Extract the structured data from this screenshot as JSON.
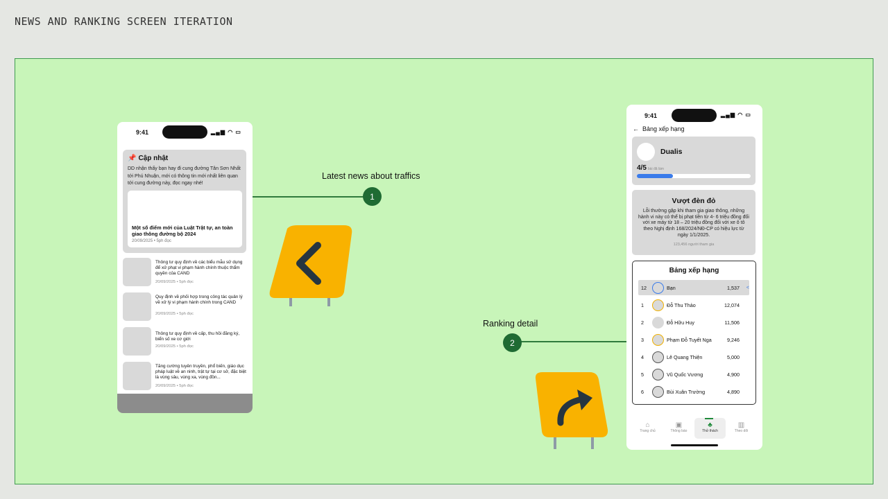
{
  "page": {
    "title": "NEWS AND RANKING SCREEN ITERATION"
  },
  "annotations": [
    {
      "number": "1",
      "label": "Latest news about traffics"
    },
    {
      "number": "2",
      "label": "Ranking detail"
    }
  ],
  "colors": {
    "canvas": "#c8f5b9",
    "sign": "#f9b200",
    "accent": "#1f6b33",
    "progress": "#3a7bea"
  },
  "news_screen": {
    "status_time": "9:41",
    "status_icons": "▂▄▆ ◠ ▭",
    "hero": {
      "icon": "pin-icon",
      "heading": "Cập nhật",
      "description": "DD nhận thấy bạn hay đi cung đường Tân Sơn Nhất tới Phú Nhuận, mới có thông tin mới nhất liên quan tới cung đường này, đọc ngay nhé!",
      "article_title": "Một số điểm mới của Luật Trật tự, an toàn giao thông đường bộ 2024",
      "article_meta": "20/09/2025  •  5ph đọc"
    },
    "items": [
      {
        "title": "Thông tư quy định về các biểu mẫu sử dụng để xử phạt vi phạm hành chính thuộc thẩm quyền của CAND",
        "meta": "20/09/2025  •  5ph đọc"
      },
      {
        "title": "Quy định về phối hợp trong công tác quản lý về xử lý vi phạm hành chính trong CAND",
        "meta": "20/09/2025  •  5ph đọc"
      },
      {
        "title": "Thông tư quy định về cấp, thu hồi đăng ký, biển số xe cơ giới",
        "meta": "20/09/2025  •  5ph đọc"
      },
      {
        "title": "Tăng cường tuyên truyền, phổ biến, giáo dục pháp luật về an ninh, trật tự tại cơ sở, đặc biệt là vùng sâu, vùng xa, vùng đồn...",
        "meta": "20/09/2025  •  5ph đọc"
      }
    ]
  },
  "ranking_screen": {
    "status_time": "9:41",
    "status_icons": "▂▄▆ ◠ ▭",
    "back_arrow": "←",
    "header_title": "Bảng xếp hạng",
    "profile": {
      "name": "Dualis",
      "score": "4/5",
      "score_caption": "bài đã làm",
      "progress": 0.32
    },
    "challenge": {
      "title": "Vượt đèn đỏ",
      "description": "Lỗi thường gặp khi tham gia giao thông, những hành vi này có thể bị phạt tiền từ 4- 6 triệu đồng đối với xe máy từ 18 – 20 triệu đồng đối với xe ô tô theo Nghị định 168/2024/NĐ-CP có hiệu lực từ ngày 1/1/2025.",
      "participants": "123,456 người tham gia"
    },
    "leaderboard": {
      "title": "Bảng xếp hạng",
      "rows": [
        {
          "rank": "12",
          "name": "Bạn",
          "score": "1,537",
          "share": "<"
        },
        {
          "rank": "1",
          "name": "Đỗ Thu Thảo",
          "score": "12,074"
        },
        {
          "rank": "2",
          "name": "Đỗ Hữu Huy",
          "score": "11,506"
        },
        {
          "rank": "3",
          "name": "Phạm Đỗ Tuyết Nga",
          "score": "9,246"
        },
        {
          "rank": "4",
          "name": "Lê Quang Thiện",
          "score": "5,000"
        },
        {
          "rank": "5",
          "name": "Vũ Quốc Vương",
          "score": "4,900"
        },
        {
          "rank": "6",
          "name": "Bùi Xuân Trường",
          "score": "4,890"
        }
      ]
    },
    "tabs": [
      {
        "label": "Trang chủ",
        "icon": "⌂"
      },
      {
        "label": "Thông báo",
        "icon": "▣"
      },
      {
        "label": "Thử thách",
        "icon": "♣"
      },
      {
        "label": "Theo dõi",
        "icon": "▥"
      }
    ]
  }
}
